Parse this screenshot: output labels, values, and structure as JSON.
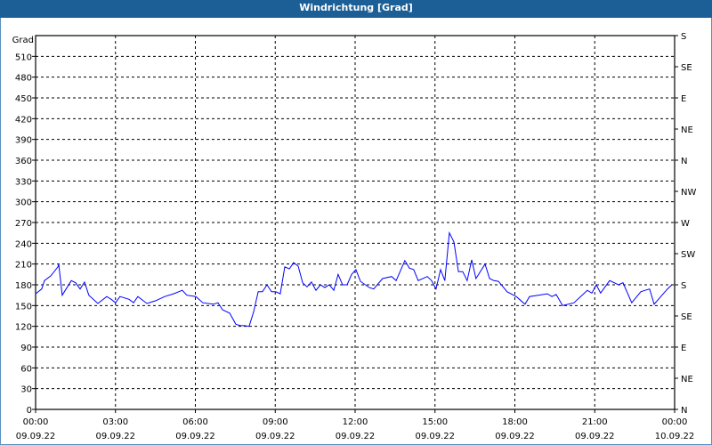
{
  "window": {
    "title": "Windrichtung [Grad]"
  },
  "chart_data": {
    "type": "line",
    "title": "Windrichtung [Grad]",
    "ylabel": "Grad",
    "ylim": [
      0,
      540
    ],
    "xlim_hours": [
      0,
      24
    ],
    "yticks": [
      0,
      30,
      60,
      90,
      120,
      150,
      180,
      210,
      240,
      270,
      300,
      330,
      360,
      390,
      420,
      450,
      480,
      510
    ],
    "right_ticks": [
      {
        "value": 0,
        "label": "N"
      },
      {
        "value": 45,
        "label": "NE"
      },
      {
        "value": 90,
        "label": "E"
      },
      {
        "value": 135,
        "label": "SE"
      },
      {
        "value": 180,
        "label": "S"
      },
      {
        "value": 225,
        "label": "SW"
      },
      {
        "value": 270,
        "label": "W"
      },
      {
        "value": 315,
        "label": "NW"
      },
      {
        "value": 360,
        "label": "N"
      },
      {
        "value": 405,
        "label": "NE"
      },
      {
        "value": 450,
        "label": "E"
      },
      {
        "value": 495,
        "label": "SE"
      },
      {
        "value": 540,
        "label": "S"
      }
    ],
    "xticks": [
      {
        "hour": 0,
        "time": "00:00",
        "date": "09.09.22"
      },
      {
        "hour": 3,
        "time": "03:00",
        "date": "09.09.22"
      },
      {
        "hour": 6,
        "time": "06:00",
        "date": "09.09.22"
      },
      {
        "hour": 9,
        "time": "09:00",
        "date": "09.09.22"
      },
      {
        "hour": 12,
        "time": "12:00",
        "date": "09.09.22"
      },
      {
        "hour": 15,
        "time": "15:00",
        "date": "09.09.22"
      },
      {
        "hour": 18,
        "time": "18:00",
        "date": "09.09.22"
      },
      {
        "hour": 21,
        "time": "21:00",
        "date": "09.09.22"
      },
      {
        "hour": 24,
        "time": "00:00",
        "date": "10.09.22"
      }
    ],
    "grid": true,
    "series": [
      {
        "name": "Windrichtung",
        "color": "#0000ff",
        "x": [
          0,
          0.23,
          0.33,
          0.57,
          0.84,
          0.87,
          1.0,
          1.34,
          1.5,
          1.67,
          1.84,
          2.0,
          2.34,
          2.67,
          2.84,
          3.0,
          3.17,
          3.51,
          3.68,
          3.84,
          4.18,
          4.51,
          4.85,
          5.18,
          5.51,
          5.68,
          6.02,
          6.28,
          6.68,
          6.85,
          7.02,
          7.29,
          7.52,
          7.69,
          7.85,
          8.02,
          8.19,
          8.36,
          8.52,
          8.69,
          8.86,
          9.02,
          9.19,
          9.36,
          9.53,
          9.69,
          9.86,
          10.03,
          10.19,
          10.36,
          10.53,
          10.7,
          10.86,
          11.03,
          11.2,
          11.36,
          11.53,
          11.7,
          11.87,
          12.03,
          12.2,
          12.53,
          12.7,
          13.03,
          13.37,
          13.54,
          13.87,
          14.04,
          14.2,
          14.37,
          14.71,
          14.87,
          15.04,
          15.21,
          15.37,
          15.54,
          15.71,
          15.88,
          16.04,
          16.21,
          16.38,
          16.54,
          16.88,
          17.05,
          17.21,
          17.38,
          17.71,
          18.05,
          18.38,
          18.55,
          18.88,
          19.22,
          19.39,
          19.55,
          19.79,
          20.22,
          20.72,
          20.89,
          21.06,
          21.22,
          21.56,
          21.89,
          22.06,
          22.39,
          22.73,
          22.89,
          23.06,
          23.23,
          23.73,
          23.9
        ],
        "y": [
          167,
          174,
          186,
          193,
          206,
          210,
          165,
          186,
          183,
          174,
          184,
          165,
          153,
          163,
          159,
          154,
          163,
          159,
          154,
          163,
          153,
          157,
          163,
          167,
          172,
          165,
          163,
          154,
          152,
          154,
          144,
          139,
          123,
          121,
          121,
          120,
          141,
          170,
          170,
          180,
          170,
          170,
          167,
          206,
          203,
          212,
          207,
          183,
          177,
          184,
          172,
          180,
          176,
          180,
          172,
          195,
          180,
          180,
          195,
          202,
          185,
          176,
          174,
          189,
          192,
          186,
          215,
          204,
          202,
          186,
          192,
          186,
          174,
          202,
          186,
          255,
          242,
          199,
          199,
          186,
          216,
          189,
          210,
          189,
          186,
          185,
          170,
          163,
          152,
          163,
          165,
          167,
          163,
          166,
          150,
          154,
          172,
          168,
          180,
          168,
          186,
          180,
          183,
          154,
          170,
          172,
          174,
          152,
          174,
          180
        ]
      }
    ]
  }
}
